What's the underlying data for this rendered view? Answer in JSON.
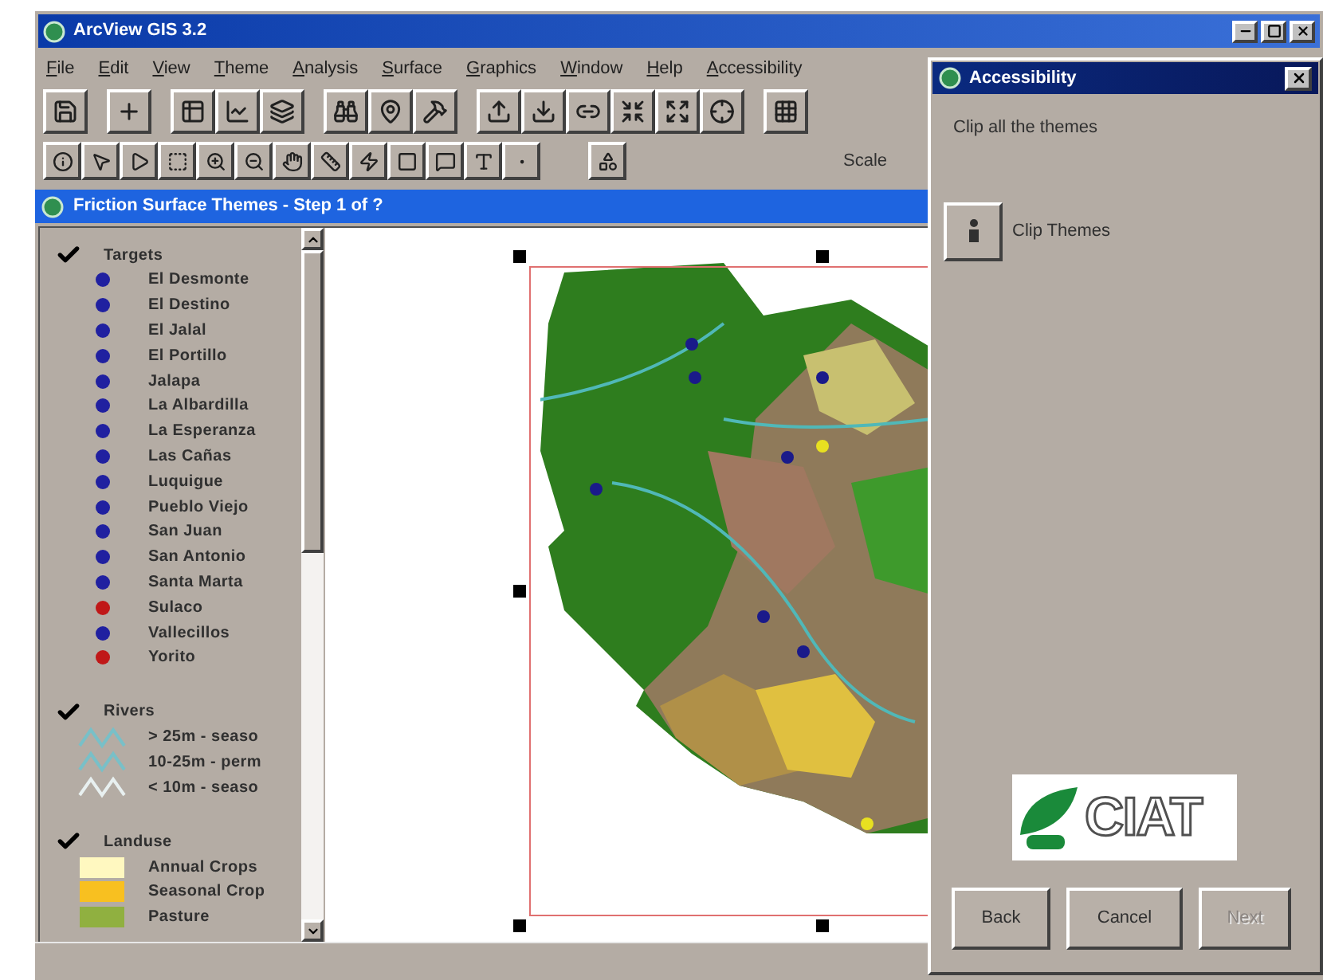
{
  "window": {
    "title": "ArcView GIS 3.2"
  },
  "menu": [
    "File",
    "Edit",
    "View",
    "Theme",
    "Analysis",
    "Surface",
    "Graphics",
    "Window",
    "Help",
    "Accessibility"
  ],
  "toolbar": {
    "scale_label": "Scale"
  },
  "view": {
    "title": "Friction Surface Themes - Step 1 of ?",
    "legend": [
      {
        "name": "Targets",
        "checked": true,
        "items": [
          {
            "kind": "point",
            "label": "El Desmonte",
            "color": "#2020a0"
          },
          {
            "kind": "point",
            "label": "El Destino",
            "color": "#2020a0"
          },
          {
            "kind": "point",
            "label": "El Jalal",
            "color": "#2020a0"
          },
          {
            "kind": "point",
            "label": "El Portillo",
            "color": "#2020a0"
          },
          {
            "kind": "point",
            "label": "Jalapa",
            "color": "#2020a0"
          },
          {
            "kind": "point",
            "label": "La Albardilla",
            "color": "#2020a0"
          },
          {
            "kind": "point",
            "label": "La Esperanza",
            "color": "#2020a0"
          },
          {
            "kind": "point",
            "label": "Las Cañas",
            "color": "#2020a0"
          },
          {
            "kind": "point",
            "label": "Luquigue",
            "color": "#2020a0"
          },
          {
            "kind": "point",
            "label": "Pueblo Viejo",
            "color": "#2020a0"
          },
          {
            "kind": "point",
            "label": "San Juan",
            "color": "#2020a0"
          },
          {
            "kind": "point",
            "label": "San Antonio",
            "color": "#2020a0"
          },
          {
            "kind": "point",
            "label": "Santa Marta",
            "color": "#2020a0"
          },
          {
            "kind": "point",
            "label": "Sulaco",
            "color": "#c01818"
          },
          {
            "kind": "point",
            "label": "Vallecillos",
            "color": "#2020a0"
          },
          {
            "kind": "point",
            "label": "Yorito",
            "color": "#c01818"
          }
        ]
      },
      {
        "name": "Rivers",
        "checked": true,
        "items": [
          {
            "kind": "line",
            "label": "> 25m - seaso",
            "color": "#78c0c8"
          },
          {
            "kind": "line",
            "label": "10-25m - perm",
            "color": "#78c0c8"
          },
          {
            "kind": "line",
            "label": "< 10m - seaso",
            "color": "#e8f0f0"
          }
        ]
      },
      {
        "name": "Landuse",
        "checked": true,
        "items": [
          {
            "kind": "fill",
            "label": "Annual Crops",
            "color": "#fff8c0"
          },
          {
            "kind": "fill",
            "label": "Seasonal Crop",
            "color": "#f8c020"
          },
          {
            "kind": "fill",
            "label": "Pasture",
            "color": "#90b040"
          }
        ]
      }
    ]
  },
  "dialog": {
    "title": "Accessibility",
    "instruction": "Clip all the themes",
    "action": {
      "label": "Clip Themes"
    },
    "logo": "CIAT",
    "buttons": [
      {
        "label": "Back",
        "disabled": false
      },
      {
        "label": "Cancel",
        "disabled": false
      },
      {
        "label": "Next",
        "disabled": true
      }
    ]
  }
}
